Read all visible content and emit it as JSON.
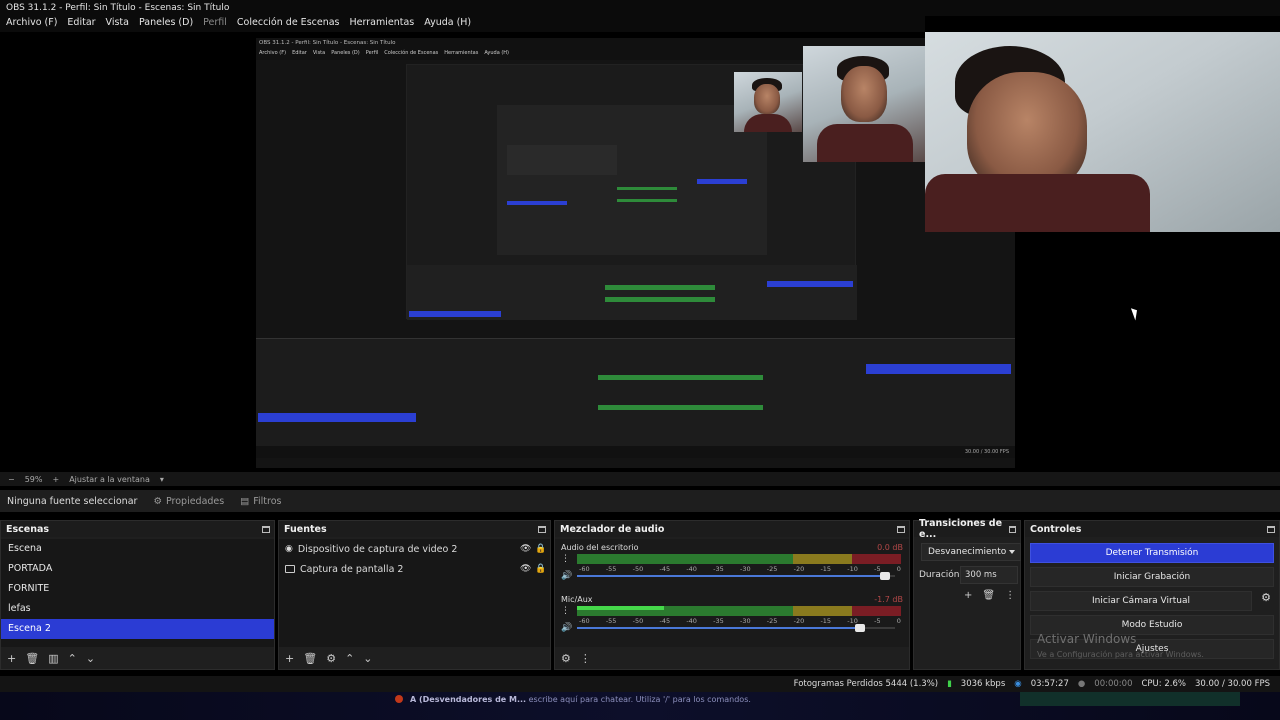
{
  "window": {
    "title": "OBS 31.1.2 - Perfil: Sin Título - Escenas: Sin Título"
  },
  "menu": [
    {
      "label": "Archivo (F)"
    },
    {
      "label": "Editar"
    },
    {
      "label": "Vista"
    },
    {
      "label": "Paneles (D)"
    },
    {
      "label": "Perfil"
    },
    {
      "label": "Colección de Escenas"
    },
    {
      "label": "Herramientas"
    },
    {
      "label": "Ayuda (H)"
    }
  ],
  "preview": {
    "zoom": "59%",
    "fit_label": "Ajustar a la ventana",
    "nested_title": "OBS 31.1.2 - Perfil: Sin Título - Escenas: Sin Título",
    "nested_menu": [
      "Archivo (F)",
      "Editar",
      "Vista",
      "Paneles (D)",
      "Perfil",
      "Colección de Escenas",
      "Herramientas",
      "Ayuda (H)"
    ]
  },
  "context": {
    "no_source": "Ninguna fuente seleccionar",
    "properties": "Propiedades",
    "filters": "Filtros"
  },
  "scenes": {
    "title": "Escenas",
    "items": [
      "Escena",
      "PORTADA",
      "FORNITE",
      "lefas",
      "Escena 2"
    ],
    "selected": "Escena 2"
  },
  "sources": {
    "title": "Fuentes",
    "items": [
      "Dispositivo de captura de video 2",
      "Captura de pantalla 2"
    ]
  },
  "mixer": {
    "title": "Mezclador de audio",
    "ticks": [
      "-60",
      "-55",
      "-50",
      "-45",
      "-40",
      "-35",
      "-30",
      "-25",
      "-20",
      "-15",
      "-10",
      "-5",
      "0"
    ],
    "channels": [
      {
        "name": "Audio del escritorio",
        "db": "0.0 dB"
      },
      {
        "name": "Mic/Aux",
        "db": "-1.7 dB"
      }
    ]
  },
  "transitions": {
    "title": "Transiciones de e...",
    "selected": "Desvanecimiento",
    "duration_label": "Duración",
    "duration_value": "300 ms"
  },
  "controls": {
    "title": "Controles",
    "stop_stream": "Detener Transmisión",
    "start_recording": "Iniciar Grabación",
    "virtual_camera": "Iniciar Cámara Virtual",
    "studio_mode": "Modo Estudio",
    "settings": "Ajustes",
    "watermark_title": "Activar Windows",
    "watermark_sub": "Ve a Configuración para activar Windows."
  },
  "status": {
    "dropped": "Fotogramas Perdidos 5444 (1.3%)",
    "bitrate": "3036 kbps",
    "stream_time": "03:57:27",
    "rec_time": "00:00:00",
    "cpu": "CPU: 2.6%",
    "fps": "30.00 / 30.00 FPS"
  },
  "taskbar": {
    "channel": "A (Desvendadores de M...",
    "chat_hint": "escribe aquí para chatear. Utiliza '/' para los comandos."
  },
  "colors": {
    "accent": "#2b3cd4",
    "meter_green": "#2b7a2f",
    "meter_yellow": "#8a7a1e",
    "meter_red": "#7a1d24",
    "signal": "#3fd24a"
  }
}
